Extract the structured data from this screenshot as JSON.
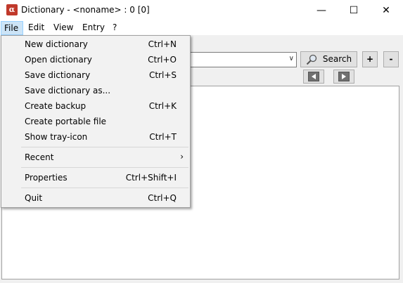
{
  "window": {
    "icon_letter": "α",
    "title": "Dictionary - <noname> : 0 [0]",
    "minimize": "—",
    "maximize": "☐",
    "close": "✕"
  },
  "menubar": {
    "file": "File",
    "edit": "Edit",
    "view": "View",
    "entry": "Entry",
    "help": "?"
  },
  "toolbar": {
    "search_label": "Search",
    "plus_label": "+",
    "minus_label": "-",
    "combo_value": ""
  },
  "file_menu": {
    "items": [
      {
        "label": "New dictionary",
        "shortcut": "Ctrl+N"
      },
      {
        "label": "Open dictionary",
        "shortcut": "Ctrl+O"
      },
      {
        "label": "Save dictionary",
        "shortcut": "Ctrl+S"
      },
      {
        "label": "Save dictionary as...",
        "shortcut": ""
      },
      {
        "label": "Create backup",
        "shortcut": "Ctrl+K"
      },
      {
        "label": "Create portable file",
        "shortcut": ""
      },
      {
        "label": "Show tray-icon",
        "shortcut": "Ctrl+T"
      },
      {
        "label": "Recent",
        "shortcut": ""
      },
      {
        "label": "Properties",
        "shortcut": "Ctrl+Shift+I"
      },
      {
        "label": "Quit",
        "shortcut": "Ctrl+Q"
      }
    ]
  }
}
